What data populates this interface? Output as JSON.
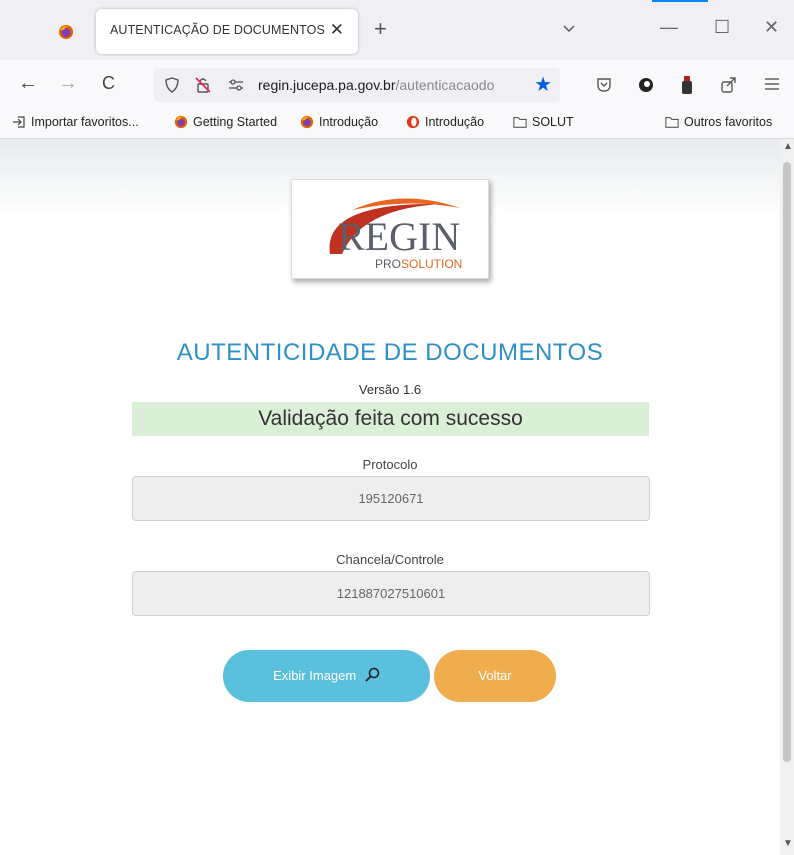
{
  "browser": {
    "tab": {
      "title": "AUTENTICAÇÃO DE DOCUMENTOS",
      "close": "✕"
    },
    "new_tab": "+",
    "controls": {
      "minimize": "—",
      "maximize": "☐",
      "close": "✕"
    },
    "nav": {
      "back": "←",
      "forward": "→",
      "reload": "C"
    },
    "url": {
      "host": "regin.jucepa.pa.gov.br",
      "path": "/autenticacaodo"
    },
    "bookmarks": [
      {
        "label": "Importar favoritos...",
        "icon": "import-icon"
      },
      {
        "label": "Getting Started",
        "icon": "firefox-icon"
      },
      {
        "label": "Introdução",
        "icon": "firefox-icon"
      },
      {
        "label": "Introdução",
        "icon": "opera-icon"
      },
      {
        "label": "SOLUT",
        "icon": "folder-icon"
      }
    ],
    "other_bookmarks": {
      "label": "Outros favoritos",
      "icon": "folder-icon"
    }
  },
  "page": {
    "logo": {
      "main": "REGIN",
      "sub_a": "PRO",
      "sub_b": "SOLUTION"
    },
    "heading": "AUTENTICIDADE DE DOCUMENTOS",
    "version": "Versão 1.6",
    "status": "Validação feita com sucesso",
    "protocolo": {
      "label": "Protocolo",
      "value": "195120671"
    },
    "chancela": {
      "label": "Chancela/Controle",
      "value": "121887027510601"
    },
    "buttons": {
      "view_image": "Exibir Imagem",
      "back": "Voltar"
    }
  },
  "colors": {
    "heading": "#2f8fc7",
    "success_bg": "#d9efd6",
    "view_button": "#5bc0de",
    "back_button": "#f0ad4e",
    "logo_red": "#c0311f",
    "logo_orange": "#e8661e"
  }
}
